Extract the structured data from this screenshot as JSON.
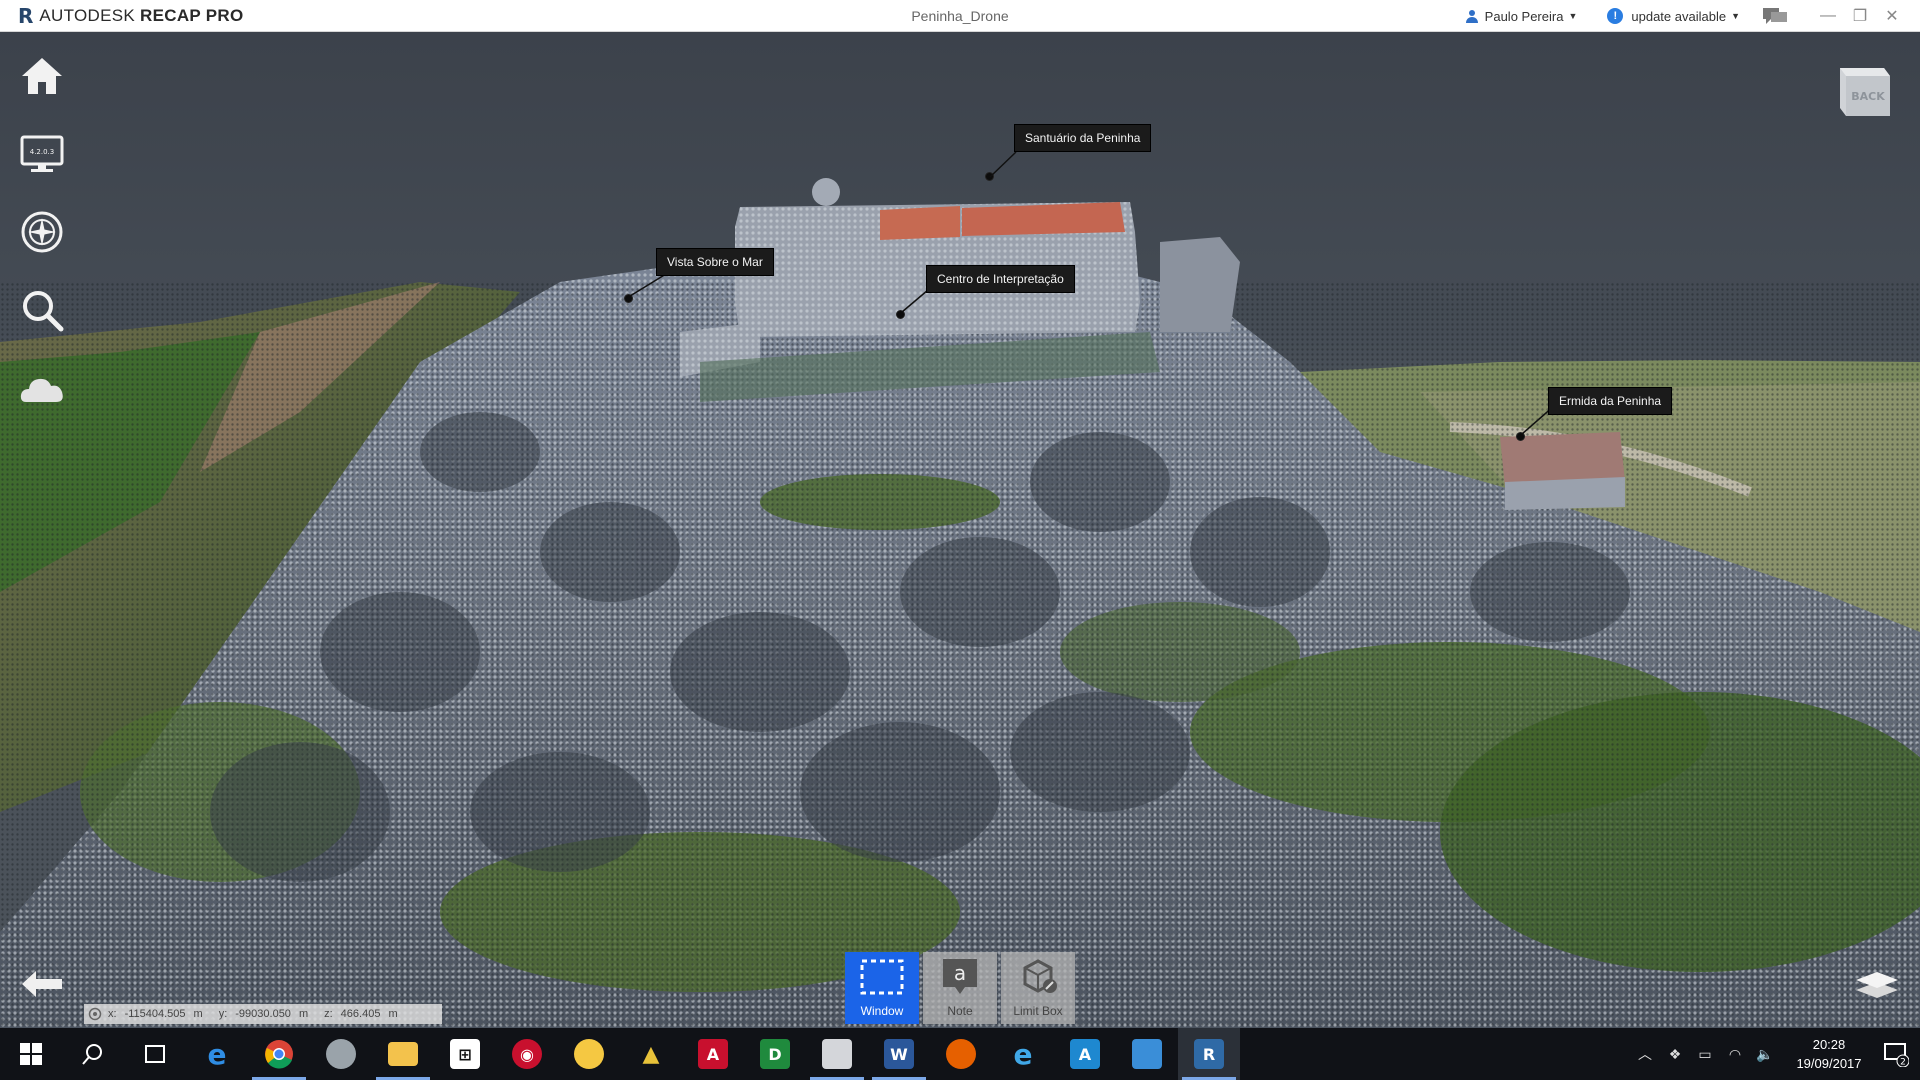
{
  "titlebar": {
    "brand_left": "AUTODESK",
    "brand_right": "RECAP PRO",
    "document": "Peninha_Drone",
    "user": "Paulo Pereira",
    "update": "update available"
  },
  "rail": {
    "items": [
      {
        "name": "home",
        "icon": "home-icon"
      },
      {
        "name": "display",
        "icon": "monitor-icon",
        "badge": "4.2.0.3"
      },
      {
        "name": "navigate",
        "icon": "compass-icon"
      },
      {
        "name": "search",
        "icon": "magnifier-icon"
      },
      {
        "name": "cloud",
        "icon": "cloud-icon"
      }
    ]
  },
  "viewcube": {
    "face": "BACK"
  },
  "annotations": [
    {
      "label": "Santuário da Peninha"
    },
    {
      "label": "Vista Sobre o Mar"
    },
    {
      "label": "Centro de Interpretação"
    },
    {
      "label": "Ermida da Peninha"
    }
  ],
  "bottom_tools": [
    {
      "label": "Window",
      "active": true
    },
    {
      "label": "Note",
      "active": false,
      "glyph": "a"
    },
    {
      "label": "Limit Box",
      "active": false
    }
  ],
  "coords": {
    "x_label": "x:",
    "x": "-115404.505",
    "x_unit": "m",
    "y_label": "y:",
    "y": "-99030.050",
    "y_unit": "m",
    "z_label": "z:",
    "z": "466.405",
    "z_unit": "m"
  },
  "taskbar": {
    "apps": [
      "Start",
      "Search",
      "Task View",
      "Edge",
      "Chrome",
      "Recap Photo",
      "File Explorer",
      "Store",
      "Autodesk App",
      "Paint",
      "Civil Road",
      "AutoCAD",
      "DWG TrueView",
      "Viewer",
      "Word",
      "Firefox",
      "Internet Explorer",
      "Autodesk A360",
      "Photos",
      "ReCap"
    ],
    "time": "20:28",
    "date": "19/09/2017",
    "notifications": "2"
  },
  "colors": {
    "accent": "#1b64e8",
    "tag_bg": "#1b1b1b",
    "brand": "#27466b"
  }
}
